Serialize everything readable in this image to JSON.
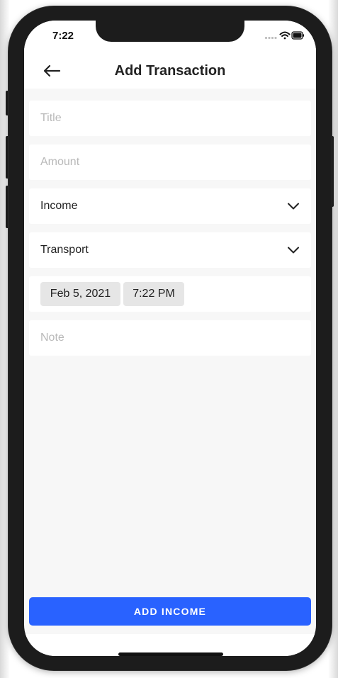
{
  "status_bar": {
    "time": "7:22",
    "icons": [
      "signal-icon",
      "wifi-icon",
      "battery-icon"
    ]
  },
  "header": {
    "title": "Add Transaction",
    "back_icon": "back-arrow-icon"
  },
  "form": {
    "title_placeholder": "Title",
    "amount_placeholder": "Amount",
    "type_value": "Income",
    "category_value": "Transport",
    "date_value": "Feb 5, 2021",
    "time_value": "7:22 PM",
    "note_placeholder": "Note"
  },
  "actions": {
    "submit_label": "ADD INCOME"
  },
  "colors": {
    "primary": "#2962ff",
    "background": "#f7f7f7",
    "card": "#ffffff",
    "chip": "#e6e6e6"
  }
}
